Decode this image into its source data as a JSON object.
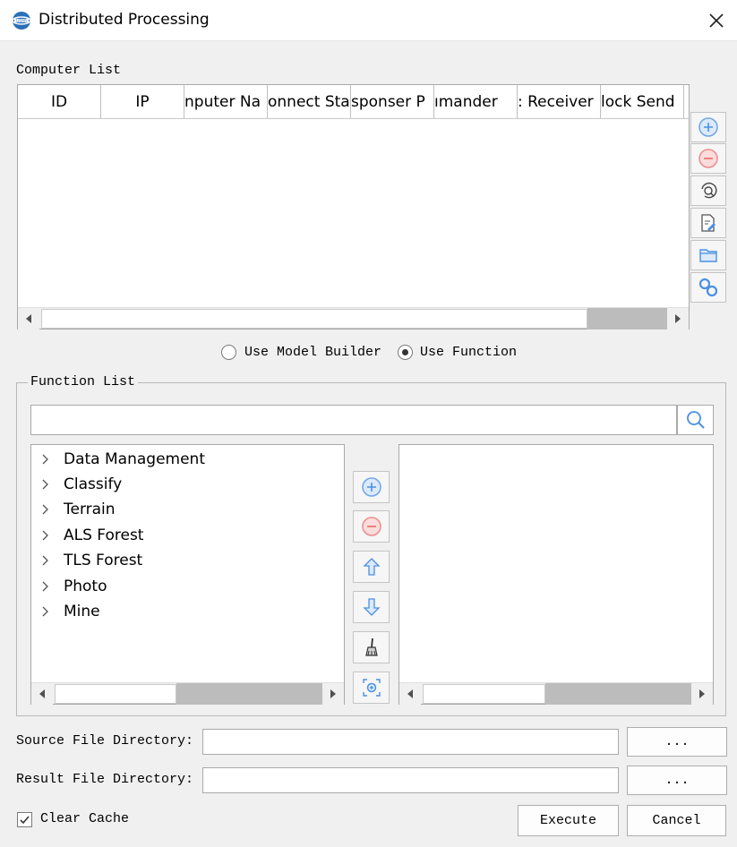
{
  "window": {
    "title": "Distributed Processing",
    "app_icon": "app-logo-icon",
    "close_icon": "close-icon"
  },
  "computer_list": {
    "label": "Computer List",
    "columns": [
      "ID",
      "IP",
      "nputer Na",
      "onnect Sta",
      "sponser P",
      "ımander",
      ": Receiver",
      "lock Send"
    ],
    "rows": [],
    "side_buttons": [
      {
        "name": "add-computer-button",
        "icon": "plus-circle-icon"
      },
      {
        "name": "remove-computer-button",
        "icon": "minus-circle-icon"
      },
      {
        "name": "search-computer-button",
        "icon": "search-refresh-icon"
      },
      {
        "name": "edit-computer-button",
        "icon": "edit-document-icon"
      },
      {
        "name": "open-folder-button",
        "icon": "folder-icon"
      },
      {
        "name": "connect-button",
        "icon": "link-icon"
      }
    ]
  },
  "mode": {
    "options": [
      "Use Model Builder",
      "Use Function"
    ],
    "selected": "Use Function"
  },
  "function_list": {
    "label": "Function List",
    "search_value": "",
    "tree_items": [
      "Data Management",
      "Classify",
      "Terrain",
      "ALS Forest",
      "TLS Forest",
      "Photo",
      "Mine"
    ],
    "selected_items": [],
    "mid_buttons": [
      {
        "name": "add-function-button",
        "icon": "plus-circle-icon"
      },
      {
        "name": "remove-function-button",
        "icon": "minus-circle-icon"
      },
      {
        "name": "move-up-button",
        "icon": "arrow-up-icon"
      },
      {
        "name": "move-down-button",
        "icon": "arrow-down-icon"
      },
      {
        "name": "clear-button",
        "icon": "brush-icon"
      },
      {
        "name": "settings-button",
        "icon": "settings-frame-icon"
      }
    ]
  },
  "source_dir": {
    "label": "Source File Directory:",
    "value": "",
    "browse_label": "..."
  },
  "result_dir": {
    "label": "Result File Directory:",
    "value": "",
    "browse_label": "..."
  },
  "clear_cache": {
    "label": "Clear Cache",
    "checked": true
  },
  "actions": {
    "execute": "Execute",
    "cancel": "Cancel"
  },
  "colors": {
    "window_bg": "#f0f0f0",
    "icon_blue": "#4a90e2",
    "icon_red": "#e86a6a",
    "scroll_track": "#bcbcbc"
  }
}
